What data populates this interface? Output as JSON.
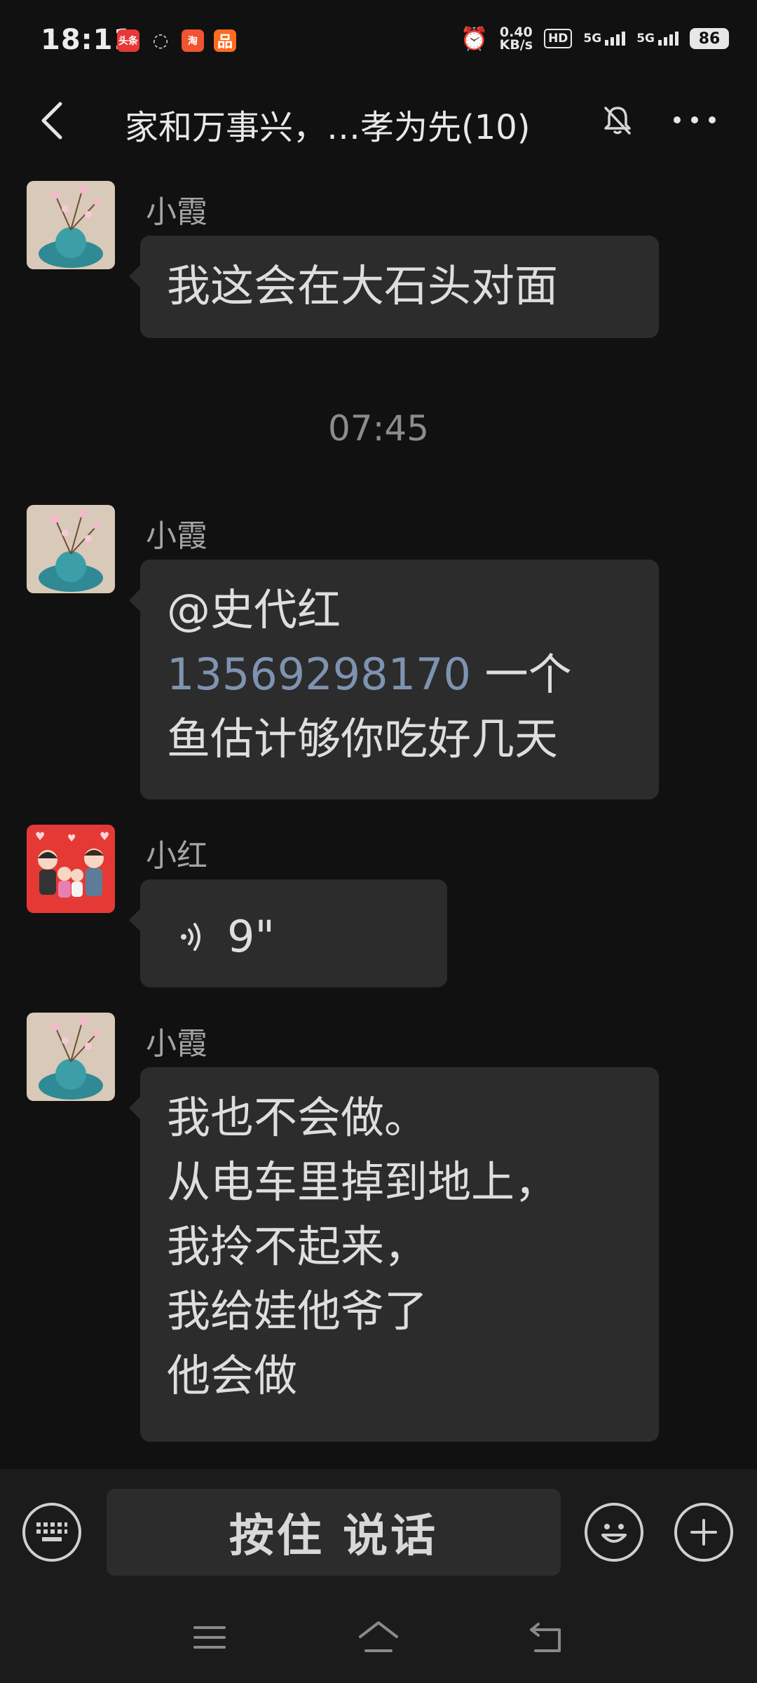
{
  "status_bar": {
    "time": "18:11",
    "app_icons": [
      "头条",
      "◌",
      "淘",
      "品"
    ],
    "net_speed_value": "0.40",
    "net_speed_unit": "KB/s",
    "hd_label": "HD",
    "signal1_label": "5G",
    "signal2_label": "5G",
    "battery": "86"
  },
  "header": {
    "title": "家和万事兴，…孝为先(10)"
  },
  "messages": [
    {
      "sender": "小霞",
      "lines": [
        "我这会在大石头对面"
      ]
    },
    {
      "timestamp": "07:45"
    },
    {
      "sender": "小霞",
      "mention": "@史代红",
      "phone": "13569298170",
      "after_phone": " 一个",
      "line3": "鱼估计够你吃好几天"
    },
    {
      "sender": "小红",
      "voice_duration": "9\""
    },
    {
      "sender": "小霞",
      "lines": [
        "我也不会做。",
        "从电车里掉到地上，",
        "我拎不起来，",
        "我给娃他爷了",
        "他会做"
      ]
    }
  ],
  "input_bar": {
    "hold_to_talk": "按住 说话"
  },
  "colors": {
    "background": "#111111",
    "bubble": "#2c2c2c",
    "phone_link": "#7e93b0"
  }
}
